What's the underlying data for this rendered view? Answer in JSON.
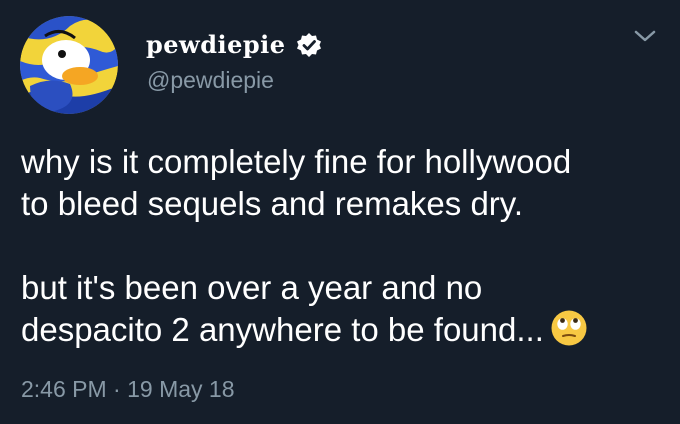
{
  "author": {
    "display_name": "реwdıерıе",
    "display_name_shown": "pewdiepie",
    "handle": "@pewdiepie",
    "verified_icon": "verified-badge-icon",
    "avatar_icon": "duck-avatar"
  },
  "tweet": {
    "lines_paragraph_1": [
      "why is it completely fine for hollywood",
      "to bleed sequels and remakes dry."
    ],
    "lines_paragraph_2": [
      "but it's been over a year and no",
      "despacito 2 anywhere to be found..."
    ],
    "emoji": "eye-roll-emoji",
    "timestamp": "2:46 PM · 19 May 18"
  },
  "menu": {
    "icon": "chevron-down-icon"
  },
  "colors": {
    "background": "#151e2a",
    "text": "#ffffff",
    "secondary": "#8899a6"
  }
}
